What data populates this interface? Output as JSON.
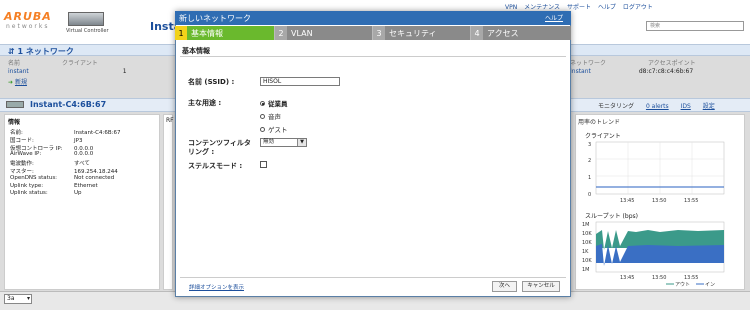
{
  "header": {
    "logo_text": "ARUBA",
    "logo_sub": "networks",
    "vc_label": "Virtual Controller",
    "title_fragment": "Instant",
    "top_nav": [
      "",
      "VPN",
      "メンテナンス",
      "サポート",
      "ヘルプ",
      "ログアウト"
    ],
    "search_placeholder": "検索"
  },
  "networks": {
    "title": "1 ネットワーク",
    "col_name": "名前",
    "col_clients": "クライアント",
    "row_name": "instant",
    "row_clients": "1",
    "new_link": "新規",
    "ap_col_1": "ネットワーク",
    "ap_col_2": "アクセスポイント",
    "ap_name": "Instant",
    "ap_mac": "d8:c7:c8:c4:6b:67"
  },
  "instant": {
    "title": "Instant-C4:6B:67",
    "monitoring": "モニタリング",
    "alerts": "0 alerts",
    "ids": "IDS",
    "settings": "設定"
  },
  "info": {
    "heading": "情報",
    "rows": [
      {
        "k": "名前:",
        "v": "Instant-C4:6B:67"
      },
      {
        "k": "国コード:",
        "v": "JP3"
      },
      {
        "k": "仮想コントローラ IP:",
        "v": "0.0.0.0"
      },
      {
        "k": "AirWave IP:",
        "v": "0.0.0.0"
      },
      {
        "k": "電波動作:",
        "v": "すべて"
      },
      {
        "k": "マスター:",
        "v": "169.254.18.244"
      },
      {
        "k": "OpenDNS status:",
        "v": "Not connected"
      },
      {
        "k": "Uplink type:",
        "v": "Ethernet"
      },
      {
        "k": "Uplink status:",
        "v": "Up"
      }
    ]
  },
  "rf_label": "RF",
  "trend": {
    "title": "用率のトレンド",
    "clients_label": "クライアント",
    "throughput_label": "スループット (bps)",
    "clients_y": [
      "3",
      "2",
      "1",
      "0"
    ],
    "times": [
      "13:45",
      "13:50",
      "13:55"
    ],
    "tp_y": [
      "1M",
      "10K",
      "10K",
      "1K",
      "10K",
      "1M"
    ],
    "legend_out": "アウト",
    "legend_in": "イン"
  },
  "bottom": {
    "zoom": "3a"
  },
  "modal": {
    "title": "新しいネットワーク",
    "help": "ヘルプ",
    "steps": [
      {
        "num": "1",
        "label": "基本情報"
      },
      {
        "num": "2",
        "label": "VLAN"
      },
      {
        "num": "3",
        "label": "セキュリティ"
      },
      {
        "num": "4",
        "label": "アクセス"
      }
    ],
    "section": "基本情報",
    "name_label": "名前 (SSID) :",
    "ssid_value": "HISOL",
    "usage_label": "主な用途 :",
    "usage_options": [
      "従業員",
      "音声",
      "ゲスト"
    ],
    "cf_label": "コンテンツフィルタリング :",
    "cf_value": "無効",
    "stealth_label": "ステルスモード :",
    "advanced_link": "詳細オプションを表示",
    "next": "次へ",
    "cancel": "キャンセル"
  },
  "colors": {
    "accent": "#2f6db3",
    "active_step": "#6ab92d",
    "active_num": "#f2d21a"
  }
}
